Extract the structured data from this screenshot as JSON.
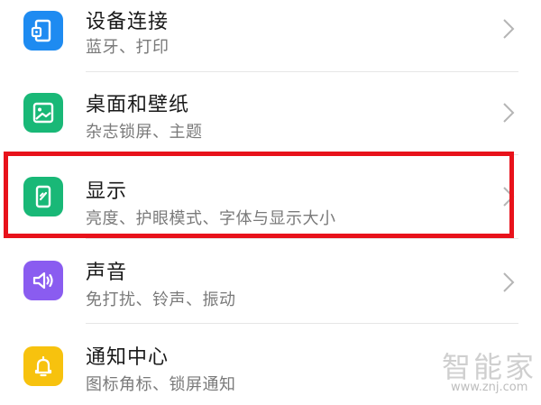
{
  "settings": {
    "items": [
      {
        "title": "设备连接",
        "subtitle": "蓝牙、打印",
        "icon": "device-connection-icon",
        "color": "#1e8bf1"
      },
      {
        "title": "桌面和壁纸",
        "subtitle": "杂志锁屏、主题",
        "icon": "wallpaper-icon",
        "color": "#19b877"
      },
      {
        "title": "显示",
        "subtitle": "亮度、护眼模式、字体与显示大小",
        "icon": "display-icon",
        "color": "#19b877"
      },
      {
        "title": "声音",
        "subtitle": "免打扰、铃声、振动",
        "icon": "sound-icon",
        "color": "#8a5cf0"
      },
      {
        "title": "通知中心",
        "subtitle": "图标角标、锁屏通知",
        "icon": "bell-icon",
        "color": "#f7c20e"
      }
    ],
    "highlight_color": "#e8121b"
  },
  "watermark": {
    "text": "智能家",
    "url": "www.znj.com"
  }
}
